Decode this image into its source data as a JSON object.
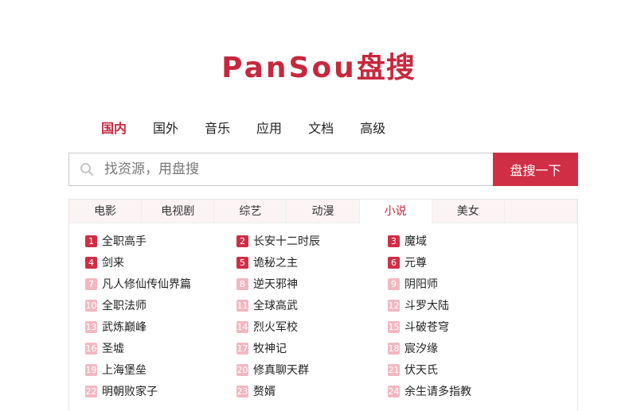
{
  "logo": {
    "latin": "PanSou",
    "cn": "盘搜"
  },
  "nav": [
    {
      "label": "国内",
      "active": true
    },
    {
      "label": "国外",
      "active": false
    },
    {
      "label": "音乐",
      "active": false
    },
    {
      "label": "应用",
      "active": false
    },
    {
      "label": "文档",
      "active": false
    },
    {
      "label": "高级",
      "active": false
    }
  ],
  "search": {
    "placeholder": "找资源，用盘搜",
    "button_label": "盘搜一下"
  },
  "tabs": [
    {
      "label": "电影",
      "active": false
    },
    {
      "label": "电视剧",
      "active": false
    },
    {
      "label": "综艺",
      "active": false
    },
    {
      "label": "动漫",
      "active": false
    },
    {
      "label": "小说",
      "active": true
    },
    {
      "label": "美女",
      "active": false
    },
    {
      "label": "",
      "active": false
    }
  ],
  "items": [
    {
      "rank": "1",
      "title": "全职高手"
    },
    {
      "rank": "2",
      "title": "长安十二时辰"
    },
    {
      "rank": "3",
      "title": "魔域"
    },
    {
      "rank": "4",
      "title": "剑来"
    },
    {
      "rank": "5",
      "title": "诡秘之主"
    },
    {
      "rank": "6",
      "title": "元尊"
    },
    {
      "rank": "7",
      "title": "凡人修仙传仙界篇"
    },
    {
      "rank": "8",
      "title": "逆天邪神"
    },
    {
      "rank": "9",
      "title": "阴阳师"
    },
    {
      "rank": "10",
      "title": "全职法师"
    },
    {
      "rank": "11",
      "title": "全球高武"
    },
    {
      "rank": "12",
      "title": "斗罗大陆"
    },
    {
      "rank": "13",
      "title": "武炼巅峰"
    },
    {
      "rank": "14",
      "title": "烈火军校"
    },
    {
      "rank": "15",
      "title": "斗破苍穹"
    },
    {
      "rank": "16",
      "title": "圣墟"
    },
    {
      "rank": "17",
      "title": "牧神记"
    },
    {
      "rank": "18",
      "title": "宸汐缘"
    },
    {
      "rank": "19",
      "title": "上海堡垒"
    },
    {
      "rank": "20",
      "title": "修真聊天群"
    },
    {
      "rank": "21",
      "title": "伏天氏"
    },
    {
      "rank": "22",
      "title": "明朝败家子"
    },
    {
      "rank": "23",
      "title": "赘婿"
    },
    {
      "rank": "24",
      "title": "余生请多指教"
    }
  ],
  "colors": {
    "brand": "#c6283e",
    "button": "#d02e45",
    "rank_top": "#d02e45",
    "rank_low": "#f2b8c2",
    "tab_bar": "#fcf3f5"
  },
  "icons": {
    "search": "search-icon"
  }
}
